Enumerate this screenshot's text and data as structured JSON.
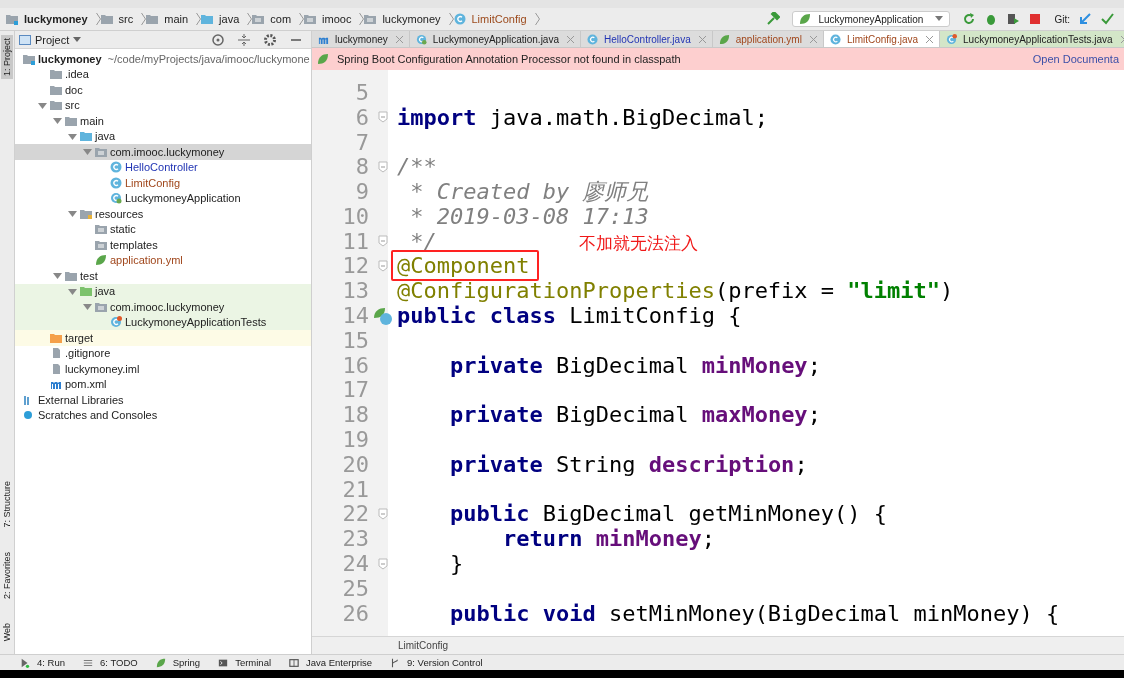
{
  "breadcrumbs": [
    {
      "label": "luckymoney",
      "kind": "module"
    },
    {
      "label": "src",
      "kind": "folder"
    },
    {
      "label": "main",
      "kind": "folder"
    },
    {
      "label": "java",
      "kind": "source"
    },
    {
      "label": "com",
      "kind": "package"
    },
    {
      "label": "imooc",
      "kind": "package"
    },
    {
      "label": "luckymoney",
      "kind": "package"
    },
    {
      "label": "LimitConfig",
      "kind": "class"
    }
  ],
  "run_config": "LuckymoneyApplication",
  "git_label": "Git:",
  "side_stripe": {
    "top": [
      {
        "label": "1: Project",
        "selected": true
      }
    ],
    "bottom": [
      {
        "label": "7: Structure",
        "selected": false
      },
      {
        "label": "2: Favorites",
        "selected": false
      },
      {
        "label": "Web",
        "selected": false
      }
    ]
  },
  "project_panel": {
    "title": "Project",
    "tree": [
      {
        "label": "luckymoney",
        "detail": "~/code/myProjects/java/imooc/luckymone",
        "kind": "module",
        "modified": false,
        "added": false,
        "selected": false,
        "children": [
          {
            "label": ".idea",
            "kind": "folder",
            "modified": false,
            "added": false,
            "selected": false
          },
          {
            "label": "doc",
            "kind": "folder",
            "modified": false,
            "added": false,
            "selected": false
          },
          {
            "label": "src",
            "kind": "folder",
            "modified": false,
            "added": false,
            "selected": false,
            "expanded": true,
            "children": [
              {
                "label": "main",
                "kind": "folder",
                "modified": false,
                "added": false,
                "selected": false,
                "expanded": true,
                "children": [
                  {
                    "label": "java",
                    "kind": "source",
                    "modified": false,
                    "added": false,
                    "selected": false,
                    "expanded": true,
                    "children": [
                      {
                        "label": "com.imooc.luckymoney",
                        "kind": "package",
                        "modified": false,
                        "added": false,
                        "selected": true,
                        "expanded": true,
                        "children": [
                          {
                            "label": "HelloController",
                            "kind": "class",
                            "modified": true,
                            "added": false,
                            "selected": false
                          },
                          {
                            "label": "LimitConfig",
                            "kind": "class",
                            "modified": false,
                            "added": true,
                            "selected": false
                          },
                          {
                            "label": "LuckymoneyApplication",
                            "kind": "spring-class",
                            "modified": false,
                            "added": false,
                            "selected": false
                          }
                        ]
                      }
                    ]
                  },
                  {
                    "label": "resources",
                    "kind": "resources",
                    "modified": false,
                    "added": false,
                    "selected": false,
                    "expanded": true,
                    "children": [
                      {
                        "label": "static",
                        "kind": "package",
                        "modified": false,
                        "added": false,
                        "selected": false
                      },
                      {
                        "label": "templates",
                        "kind": "package",
                        "modified": false,
                        "added": false,
                        "selected": false
                      },
                      {
                        "label": "application.yml",
                        "kind": "spring-file",
                        "modified": false,
                        "added": true,
                        "selected": false
                      }
                    ]
                  }
                ]
              },
              {
                "label": "test",
                "kind": "folder",
                "modified": false,
                "added": false,
                "selected": false,
                "expanded": true,
                "children": [
                  {
                    "label": "java",
                    "kind": "test-folder",
                    "modified": false,
                    "added": false,
                    "selected": false,
                    "expanded": true,
                    "children": [
                      {
                        "label": "com.imooc.luckymoney",
                        "kind": "test-package",
                        "modified": false,
                        "added": false,
                        "selected": false,
                        "expanded": true,
                        "children": [
                          {
                            "label": "LuckymoneyApplicationTests",
                            "kind": "test-class",
                            "modified": false,
                            "added": false,
                            "selected": false
                          }
                        ]
                      }
                    ]
                  }
                ]
              }
            ]
          },
          {
            "label": "target",
            "kind": "excluded",
            "modified": false,
            "added": false,
            "selected": false
          },
          {
            "label": ".gitignore",
            "kind": "file",
            "modified": false,
            "added": false,
            "selected": false
          },
          {
            "label": "luckymoney.iml",
            "kind": "file",
            "modified": false,
            "added": false,
            "selected": false
          },
          {
            "label": "pom.xml",
            "kind": "maven",
            "modified": false,
            "added": false,
            "selected": false
          }
        ]
      },
      {
        "label": "External Libraries",
        "kind": "library",
        "modified": false,
        "added": false,
        "selected": false
      },
      {
        "label": "Scratches and Consoles",
        "kind": "scratch",
        "modified": false,
        "added": false,
        "selected": false
      }
    ]
  },
  "editor": {
    "tabs": [
      {
        "label": "luckymoney",
        "kind": "maven",
        "modified": false,
        "added": false,
        "selected": false
      },
      {
        "label": "LuckymoneyApplication.java",
        "kind": "spring-class",
        "modified": false,
        "added": false,
        "selected": false
      },
      {
        "label": "HelloController.java",
        "kind": "class",
        "modified": true,
        "added": false,
        "selected": false
      },
      {
        "label": "application.yml",
        "kind": "spring-file",
        "modified": false,
        "added": true,
        "selected": false
      },
      {
        "label": "LimitConfig.java",
        "kind": "class",
        "modified": false,
        "added": true,
        "selected": true
      },
      {
        "label": "LuckymoneyApplicationTests.java",
        "kind": "test-class",
        "modified": false,
        "added": false,
        "selected": false
      }
    ],
    "banner": {
      "message": "Spring Boot Configuration Annotation Processor not found in classpath",
      "link": "Open Documenta"
    },
    "lines": [
      {
        "number": "5",
        "kind": "plain"
      },
      {
        "number": "6",
        "kind": "fold",
        "tokens": [
          {
            "kind": "keyword",
            "text": "import"
          },
          {
            "kind": "plain",
            "text": " java.math.BigDecimal;"
          }
        ]
      },
      {
        "number": "7",
        "kind": "plain"
      },
      {
        "number": "8",
        "kind": "fold",
        "tokens": [
          {
            "kind": "comment",
            "text": "/**"
          }
        ]
      },
      {
        "number": "9",
        "kind": "plain",
        "tokens": [
          {
            "kind": "comment",
            "text": " * Created by 廖师兄"
          }
        ]
      },
      {
        "number": "10",
        "kind": "plain",
        "tokens": [
          {
            "kind": "comment",
            "text": " * 2019-03-08 17:13"
          }
        ]
      },
      {
        "number": "11",
        "kind": "fold",
        "tokens": [
          {
            "kind": "comment",
            "text": " */"
          }
        ]
      },
      {
        "number": "12",
        "kind": "fold",
        "boxed": true,
        "callout": "不加就无法注入",
        "tokens": [
          {
            "kind": "annotation",
            "text": "@Component"
          }
        ]
      },
      {
        "number": "13",
        "kind": "plain",
        "tokens": [
          {
            "kind": "annotation",
            "text": "@ConfigurationProperties"
          },
          {
            "kind": "plain",
            "text": "(prefix = "
          },
          {
            "kind": "string",
            "text": "\"limit\""
          },
          {
            "kind": "plain",
            "text": ")"
          }
        ]
      },
      {
        "number": "14",
        "kind": "bean",
        "tokens": [
          {
            "kind": "keyword",
            "text": "public class"
          },
          {
            "kind": "plain",
            "text": " LimitConfig {"
          }
        ]
      },
      {
        "number": "15",
        "kind": "plain"
      },
      {
        "number": "16",
        "kind": "plain",
        "tokens": [
          {
            "kind": "keyword",
            "text": "    private"
          },
          {
            "kind": "plain",
            "text": " BigDecimal "
          },
          {
            "kind": "field",
            "text": "minMoney"
          },
          {
            "kind": "plain",
            "text": ";"
          }
        ]
      },
      {
        "number": "17",
        "kind": "plain"
      },
      {
        "number": "18",
        "kind": "plain",
        "tokens": [
          {
            "kind": "keyword",
            "text": "    private"
          },
          {
            "kind": "plain",
            "text": " BigDecimal "
          },
          {
            "kind": "field",
            "text": "maxMoney"
          },
          {
            "kind": "plain",
            "text": ";"
          }
        ]
      },
      {
        "number": "19",
        "kind": "plain"
      },
      {
        "number": "20",
        "kind": "plain",
        "tokens": [
          {
            "kind": "keyword",
            "text": "    private"
          },
          {
            "kind": "plain",
            "text": " String "
          },
          {
            "kind": "field",
            "text": "description"
          },
          {
            "kind": "plain",
            "text": ";"
          }
        ]
      },
      {
        "number": "21",
        "kind": "plain"
      },
      {
        "number": "22",
        "kind": "fold",
        "tokens": [
          {
            "kind": "keyword",
            "text": "    public"
          },
          {
            "kind": "plain",
            "text": " BigDecimal getMinMoney() {"
          }
        ]
      },
      {
        "number": "23",
        "kind": "plain",
        "tokens": [
          {
            "kind": "keyword",
            "text": "        return"
          },
          {
            "kind": "field",
            "text": " minMoney"
          },
          {
            "kind": "plain",
            "text": ";"
          }
        ]
      },
      {
        "number": "24",
        "kind": "fold",
        "tokens": [
          {
            "kind": "plain",
            "text": "    }"
          }
        ]
      },
      {
        "number": "25",
        "kind": "plain"
      },
      {
        "number": "26",
        "kind": "plain",
        "tokens": [
          {
            "kind": "keyword",
            "text": "    public void"
          },
          {
            "kind": "plain",
            "text": " setMinMoney(BigDecimal minMoney) {"
          }
        ]
      }
    ],
    "footer_crumb": "LimitConfig"
  },
  "bottom_tools": [
    {
      "label": "4: Run",
      "kind": "run"
    },
    {
      "label": "6: TODO",
      "kind": "list"
    },
    {
      "label": "Spring",
      "kind": "leaf"
    },
    {
      "label": "Terminal",
      "kind": "terminal"
    },
    {
      "label": "Java Enterprise",
      "kind": "window"
    },
    {
      "label": "9: Version Control",
      "kind": "branch"
    }
  ]
}
